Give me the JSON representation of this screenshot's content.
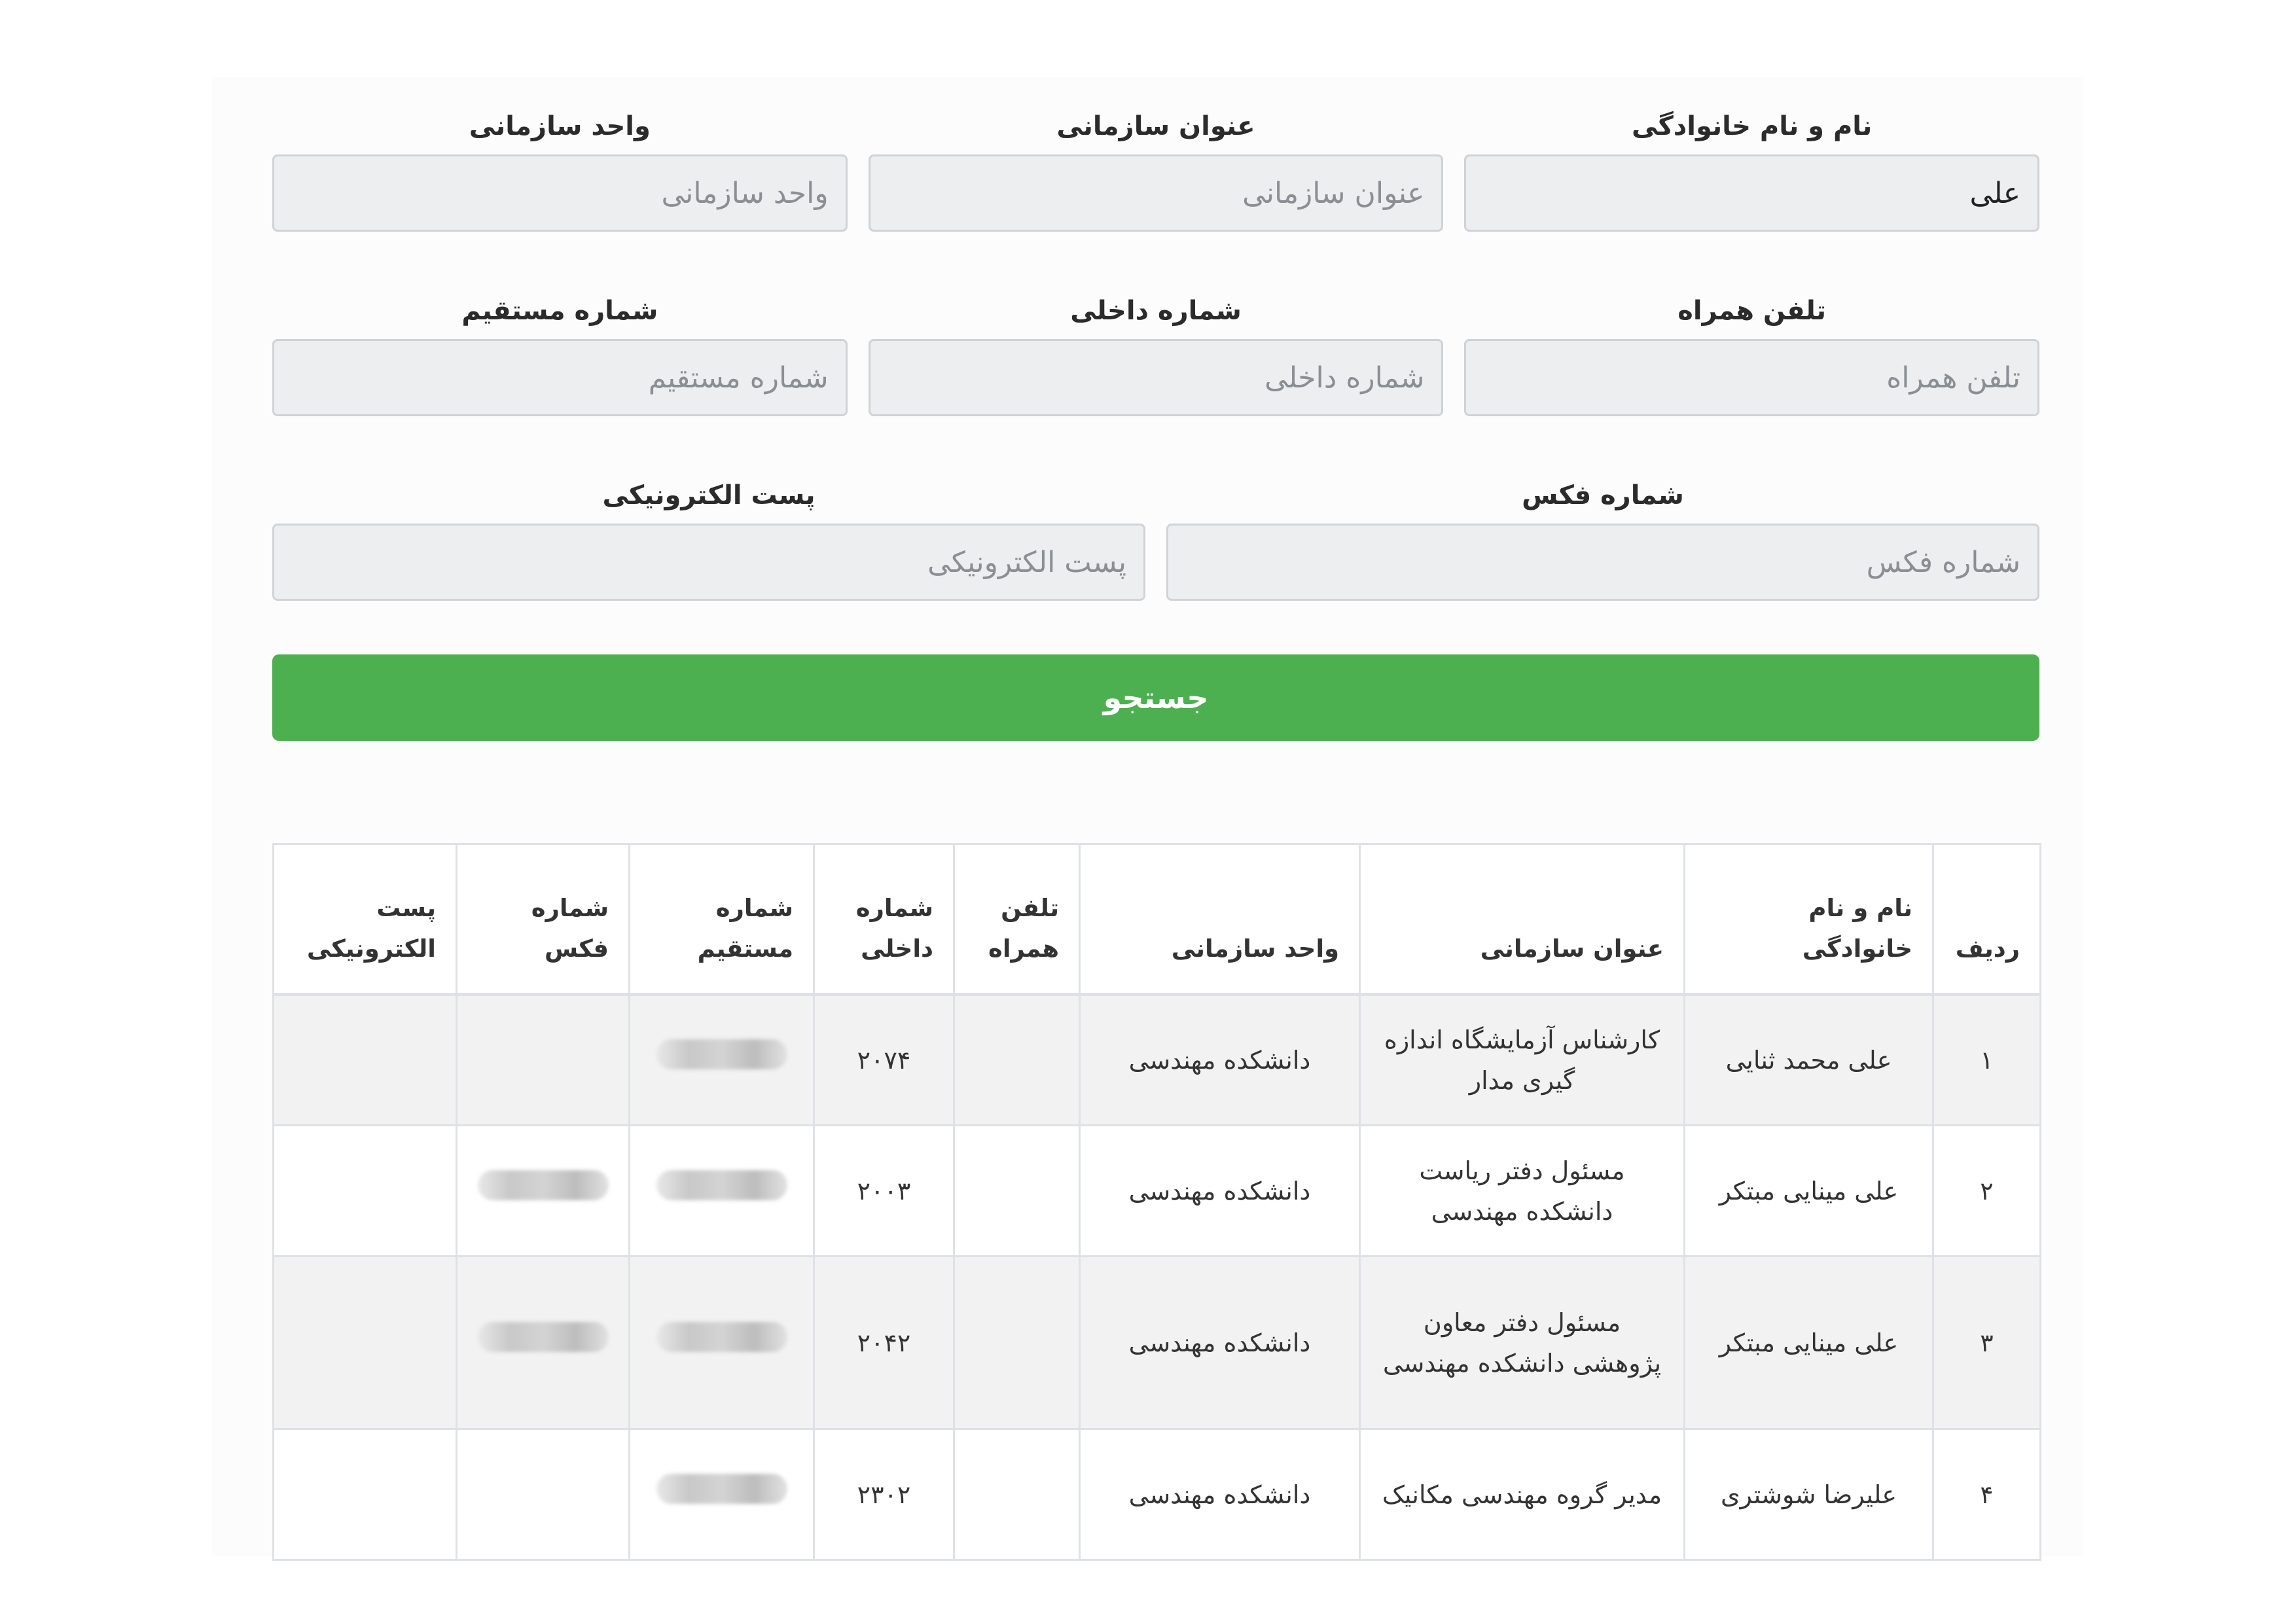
{
  "form": {
    "full_name": {
      "label": "نام و نام خانوادگی",
      "value": "علی",
      "placeholder": ""
    },
    "org_title": {
      "label": "عنوان سازمانی",
      "value": "",
      "placeholder": "عنوان سازمانی"
    },
    "org_unit": {
      "label": "واحد سازمانی",
      "value": "",
      "placeholder": "واحد سازمانی"
    },
    "mobile": {
      "label": "تلفن همراه",
      "value": "",
      "placeholder": "تلفن همراه"
    },
    "internal": {
      "label": "شماره داخلی",
      "value": "",
      "placeholder": "شماره داخلی"
    },
    "direct": {
      "label": "شماره مستقیم",
      "value": "",
      "placeholder": "شماره مستقیم"
    },
    "fax": {
      "label": "شماره فکس",
      "value": "",
      "placeholder": "شماره فکس"
    },
    "email": {
      "label": "پست الکترونیکی",
      "value": "",
      "placeholder": "پست الکترونیکی"
    },
    "search_label": "جستجو",
    "search_color": "#4caf50"
  },
  "table": {
    "headers": [
      "ردیف",
      "نام و نام خانوادگی",
      "عنوان سازمانی",
      "واحد سازمانی",
      "تلفن همراه",
      "شماره داخلی",
      "شماره مستقیم",
      "شماره فکس",
      "پست الکترونیکی"
    ],
    "rows": [
      {
        "index": "۱",
        "name": "علی محمد ثنایی",
        "title": "کارشناس آزمایشگاه اندازه گیری مدار",
        "unit": "دانشکده مهندسی",
        "mobile": "",
        "internal": "۲۰۷۴",
        "direct_redacted": true,
        "fax_redacted": false,
        "email": ""
      },
      {
        "index": "۲",
        "name": "علی مینایی مبتکر",
        "title": "مسئول دفتر ریاست دانشکده مهندسی",
        "unit": "دانشکده مهندسی",
        "mobile": "",
        "internal": "۲۰۰۳",
        "direct_redacted": true,
        "fax_redacted": true,
        "email": ""
      },
      {
        "index": "۳",
        "name": "علی مینایی مبتکر",
        "title": "مسئول دفتر معاون پژوهشی دانشکده مهندسی",
        "unit": "دانشکده مهندسی",
        "mobile": "",
        "internal": "۲۰۴۲",
        "direct_redacted": true,
        "fax_redacted": true,
        "email": ""
      },
      {
        "index": "۴",
        "name": "علیرضا شوشتری",
        "title": "مدیر گروه مهندسی مکانیک",
        "unit": "دانشکده مهندسی",
        "mobile": "",
        "internal": "۲۳۰۲",
        "direct_redacted": true,
        "fax_redacted": false,
        "email": ""
      }
    ]
  }
}
